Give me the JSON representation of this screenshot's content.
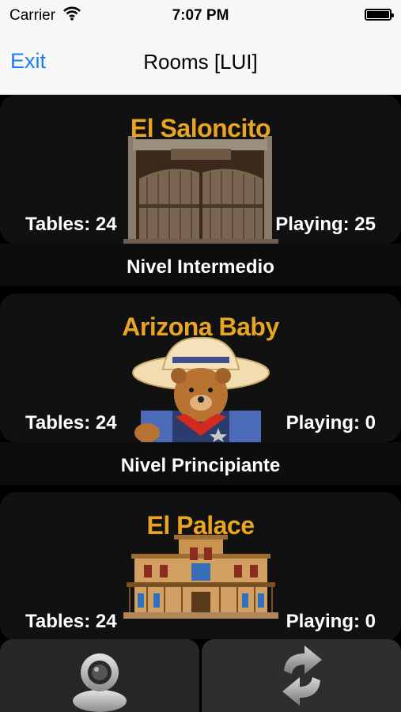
{
  "status_bar": {
    "carrier": "Carrier",
    "time": "7:07 PM"
  },
  "nav": {
    "exit_label": "Exit",
    "title": "Rooms [LUI]"
  },
  "rooms": [
    {
      "name": "El Saloncito",
      "tables": "Tables: 24",
      "playing": "Playing: 25",
      "level": "Nivel Intermedio",
      "image": "saloon-doors"
    },
    {
      "name": "Arizona Baby",
      "tables": "Tables: 24",
      "playing": "Playing: 0",
      "level": "Nivel Principiante",
      "image": "cowboy-teddy-bear"
    },
    {
      "name": "El Palace",
      "tables": "Tables: 24",
      "playing": "Playing: 0",
      "level": "",
      "image": "western-palace-building"
    }
  ],
  "tabbar": {
    "tabs": [
      {
        "icon": "user-profile-icon"
      },
      {
        "icon": "refresh-icon"
      }
    ]
  },
  "colors": {
    "room_title": "#e8a521",
    "link": "#1e7cf6",
    "card": "#111111"
  }
}
